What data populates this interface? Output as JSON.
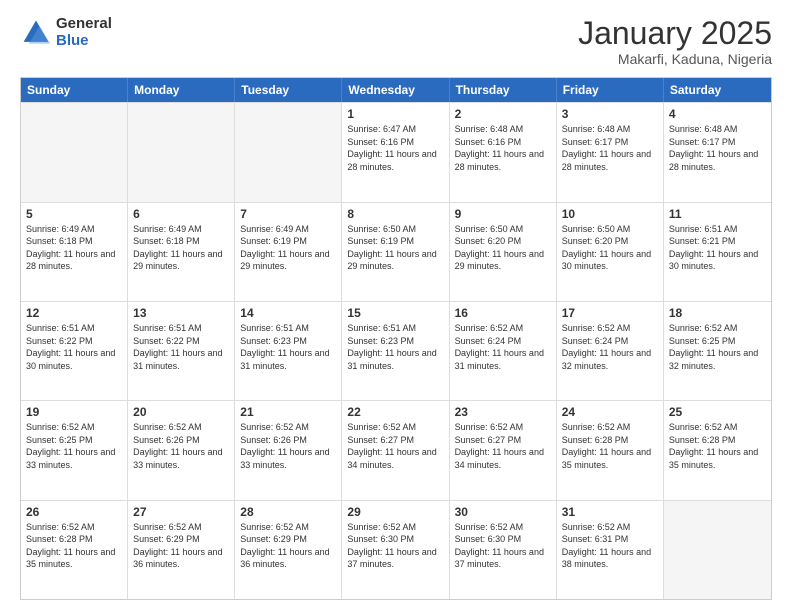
{
  "header": {
    "logo_general": "General",
    "logo_blue": "Blue",
    "title": "January 2025",
    "location": "Makarfi, Kaduna, Nigeria"
  },
  "days_of_week": [
    "Sunday",
    "Monday",
    "Tuesday",
    "Wednesday",
    "Thursday",
    "Friday",
    "Saturday"
  ],
  "weeks": [
    [
      {
        "date": "",
        "empty": true
      },
      {
        "date": "",
        "empty": true
      },
      {
        "date": "",
        "empty": true
      },
      {
        "date": "1",
        "sunrise": "6:47 AM",
        "sunset": "6:16 PM",
        "daylight": "11 hours and 28 minutes."
      },
      {
        "date": "2",
        "sunrise": "6:48 AM",
        "sunset": "6:16 PM",
        "daylight": "11 hours and 28 minutes."
      },
      {
        "date": "3",
        "sunrise": "6:48 AM",
        "sunset": "6:17 PM",
        "daylight": "11 hours and 28 minutes."
      },
      {
        "date": "4",
        "sunrise": "6:48 AM",
        "sunset": "6:17 PM",
        "daylight": "11 hours and 28 minutes."
      }
    ],
    [
      {
        "date": "5",
        "sunrise": "6:49 AM",
        "sunset": "6:18 PM",
        "daylight": "11 hours and 28 minutes."
      },
      {
        "date": "6",
        "sunrise": "6:49 AM",
        "sunset": "6:18 PM",
        "daylight": "11 hours and 29 minutes."
      },
      {
        "date": "7",
        "sunrise": "6:49 AM",
        "sunset": "6:19 PM",
        "daylight": "11 hours and 29 minutes."
      },
      {
        "date": "8",
        "sunrise": "6:50 AM",
        "sunset": "6:19 PM",
        "daylight": "11 hours and 29 minutes."
      },
      {
        "date": "9",
        "sunrise": "6:50 AM",
        "sunset": "6:20 PM",
        "daylight": "11 hours and 29 minutes."
      },
      {
        "date": "10",
        "sunrise": "6:50 AM",
        "sunset": "6:20 PM",
        "daylight": "11 hours and 30 minutes."
      },
      {
        "date": "11",
        "sunrise": "6:51 AM",
        "sunset": "6:21 PM",
        "daylight": "11 hours and 30 minutes."
      }
    ],
    [
      {
        "date": "12",
        "sunrise": "6:51 AM",
        "sunset": "6:22 PM",
        "daylight": "11 hours and 30 minutes."
      },
      {
        "date": "13",
        "sunrise": "6:51 AM",
        "sunset": "6:22 PM",
        "daylight": "11 hours and 31 minutes."
      },
      {
        "date": "14",
        "sunrise": "6:51 AM",
        "sunset": "6:23 PM",
        "daylight": "11 hours and 31 minutes."
      },
      {
        "date": "15",
        "sunrise": "6:51 AM",
        "sunset": "6:23 PM",
        "daylight": "11 hours and 31 minutes."
      },
      {
        "date": "16",
        "sunrise": "6:52 AM",
        "sunset": "6:24 PM",
        "daylight": "11 hours and 31 minutes."
      },
      {
        "date": "17",
        "sunrise": "6:52 AM",
        "sunset": "6:24 PM",
        "daylight": "11 hours and 32 minutes."
      },
      {
        "date": "18",
        "sunrise": "6:52 AM",
        "sunset": "6:25 PM",
        "daylight": "11 hours and 32 minutes."
      }
    ],
    [
      {
        "date": "19",
        "sunrise": "6:52 AM",
        "sunset": "6:25 PM",
        "daylight": "11 hours and 33 minutes."
      },
      {
        "date": "20",
        "sunrise": "6:52 AM",
        "sunset": "6:26 PM",
        "daylight": "11 hours and 33 minutes."
      },
      {
        "date": "21",
        "sunrise": "6:52 AM",
        "sunset": "6:26 PM",
        "daylight": "11 hours and 33 minutes."
      },
      {
        "date": "22",
        "sunrise": "6:52 AM",
        "sunset": "6:27 PM",
        "daylight": "11 hours and 34 minutes."
      },
      {
        "date": "23",
        "sunrise": "6:52 AM",
        "sunset": "6:27 PM",
        "daylight": "11 hours and 34 minutes."
      },
      {
        "date": "24",
        "sunrise": "6:52 AM",
        "sunset": "6:28 PM",
        "daylight": "11 hours and 35 minutes."
      },
      {
        "date": "25",
        "sunrise": "6:52 AM",
        "sunset": "6:28 PM",
        "daylight": "11 hours and 35 minutes."
      }
    ],
    [
      {
        "date": "26",
        "sunrise": "6:52 AM",
        "sunset": "6:28 PM",
        "daylight": "11 hours and 35 minutes."
      },
      {
        "date": "27",
        "sunrise": "6:52 AM",
        "sunset": "6:29 PM",
        "daylight": "11 hours and 36 minutes."
      },
      {
        "date": "28",
        "sunrise": "6:52 AM",
        "sunset": "6:29 PM",
        "daylight": "11 hours and 36 minutes."
      },
      {
        "date": "29",
        "sunrise": "6:52 AM",
        "sunset": "6:30 PM",
        "daylight": "11 hours and 37 minutes."
      },
      {
        "date": "30",
        "sunrise": "6:52 AM",
        "sunset": "6:30 PM",
        "daylight": "11 hours and 37 minutes."
      },
      {
        "date": "31",
        "sunrise": "6:52 AM",
        "sunset": "6:31 PM",
        "daylight": "11 hours and 38 minutes."
      },
      {
        "date": "",
        "empty": true
      }
    ]
  ],
  "labels": {
    "sunrise": "Sunrise:",
    "sunset": "Sunset:",
    "daylight": "Daylight:"
  }
}
